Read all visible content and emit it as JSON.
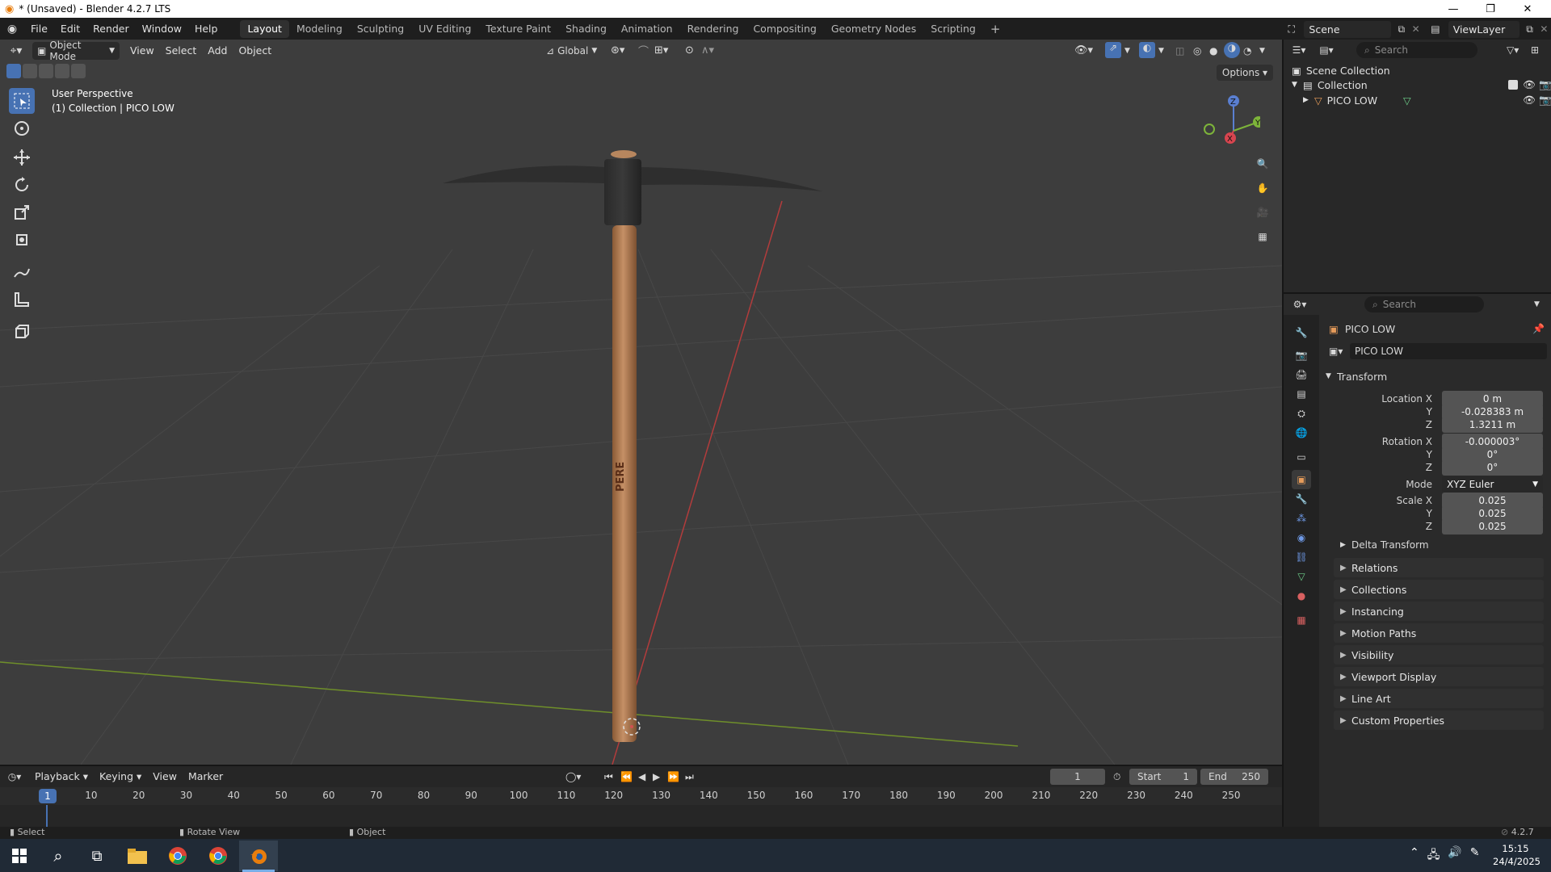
{
  "window": {
    "title": "* (Unsaved) - Blender 4.2.7 LTS"
  },
  "menu": {
    "file": "File",
    "edit": "Edit",
    "render": "Render",
    "window": "Window",
    "help": "Help"
  },
  "workspaces": [
    "Layout",
    "Modeling",
    "Sculpting",
    "UV Editing",
    "Texture Paint",
    "Shading",
    "Animation",
    "Rendering",
    "Compositing",
    "Geometry Nodes",
    "Scripting"
  ],
  "active_workspace": "Layout",
  "scene": {
    "name": "Scene",
    "view_layer": "ViewLayer"
  },
  "viewport": {
    "mode": "Object Mode",
    "menus": [
      "View",
      "Select",
      "Add",
      "Object"
    ],
    "orientation": "Global",
    "options_label": "Options",
    "overlay_line1": "User Perspective",
    "overlay_line2": "(1) Collection | PICO LOW",
    "handle_text": "PERE",
    "gizmo": {
      "x": "X",
      "y": "Y",
      "z": "Z"
    }
  },
  "outliner": {
    "search_placeholder": "Search",
    "scene_collection": "Scene Collection",
    "collection": "Collection",
    "object": "PICO LOW"
  },
  "properties": {
    "search_placeholder": "Search",
    "object_name": "PICO LOW",
    "object_field": "PICO LOW",
    "transform_label": "Transform",
    "location": {
      "label": "Location X",
      "x": "0 m",
      "y": "-0.028383 m",
      "z": "1.3211 m"
    },
    "rotation": {
      "label": "Rotation X",
      "x": "-0.000003°",
      "y": "0°",
      "z": "0°"
    },
    "mode_label": "Mode",
    "mode_value": "XYZ Euler",
    "scale": {
      "label": "Scale X",
      "x": "0.025",
      "y": "0.025",
      "z": "0.025"
    },
    "y_label": "Y",
    "z_label": "Z",
    "delta_transform": "Delta Transform",
    "panels": [
      "Relations",
      "Collections",
      "Instancing",
      "Motion Paths",
      "Visibility",
      "Viewport Display",
      "Line Art",
      "Custom Properties"
    ]
  },
  "timeline": {
    "menus": [
      "Playback",
      "Keying",
      "View",
      "Marker"
    ],
    "current_frame": "1",
    "start_label": "Start",
    "start": "1",
    "end_label": "End",
    "end": "250",
    "ruler": [
      "10",
      "20",
      "30",
      "40",
      "50",
      "60",
      "70",
      "80",
      "90",
      "100",
      "110",
      "120",
      "130",
      "140",
      "150",
      "160",
      "170",
      "180",
      "190",
      "200",
      "210",
      "220",
      "230",
      "240",
      "250"
    ],
    "ruler_current": "1"
  },
  "status": {
    "select": "Select",
    "rotate": "Rotate View",
    "object": "Object",
    "version": "4.2.7"
  },
  "taskbar": {
    "time": "15:15",
    "date": "24/4/2025"
  }
}
